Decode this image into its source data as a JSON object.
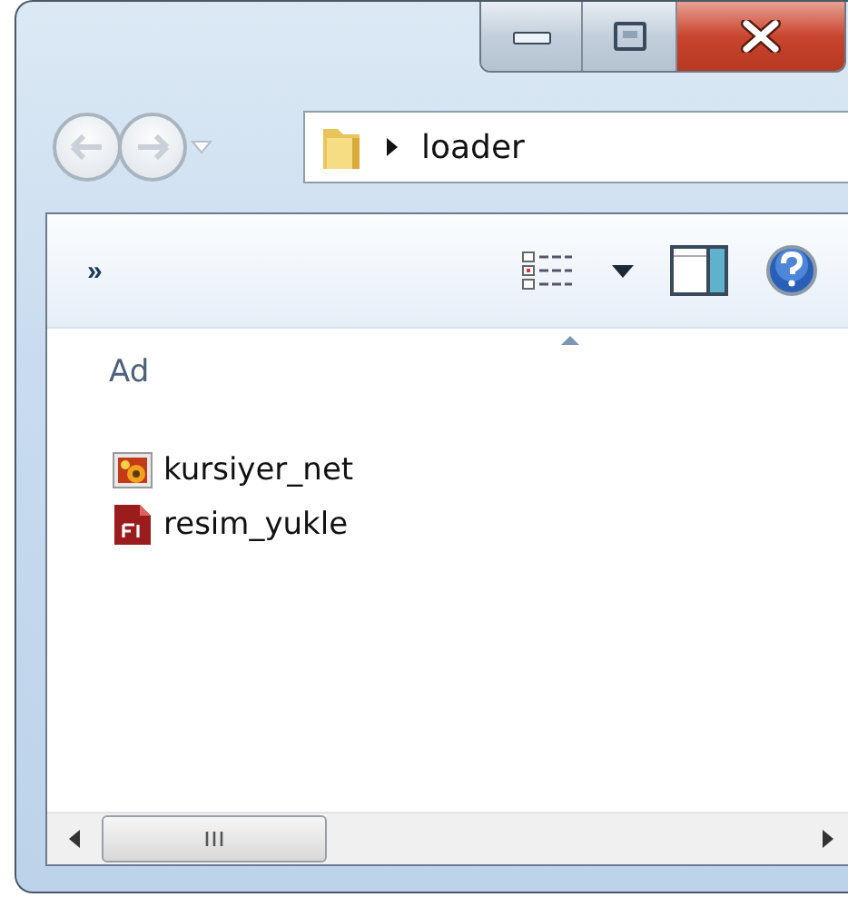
{
  "address_bar": {
    "path": "loader"
  },
  "toolbar": {
    "overflow": "»"
  },
  "file_list": {
    "column_header": "Ad",
    "files": [
      {
        "name": "kursiyer_net",
        "kind": "image"
      },
      {
        "name": "resim_yukle",
        "kind": "flash"
      }
    ]
  }
}
